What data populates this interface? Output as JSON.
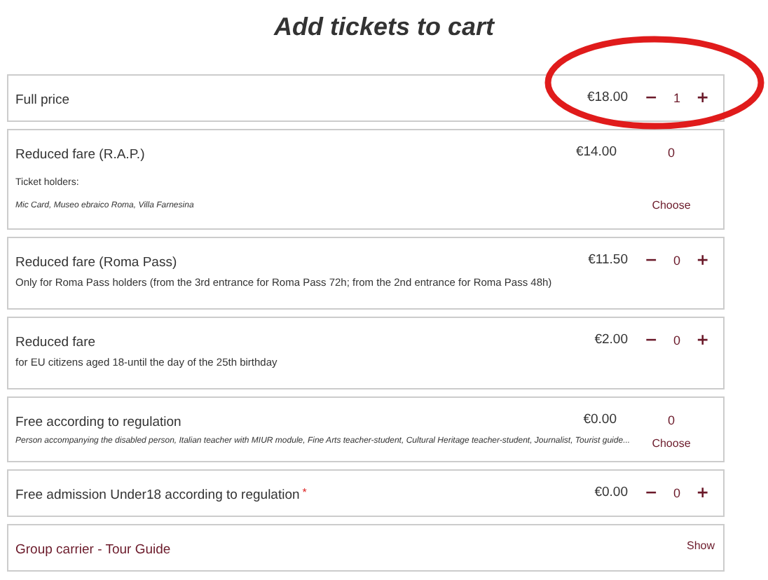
{
  "title": "Add tickets to cart",
  "tickets": [
    {
      "kind": "stepper",
      "name": "Full price",
      "price": "€18.00",
      "minus": "−",
      "quantity": "1",
      "plus": "+"
    },
    {
      "kind": "choose",
      "name": "Reduced fare (R.A.P.)",
      "price": "€14.00",
      "quantity": "0",
      "holders_label": "Ticket holders:",
      "note": "Mic Card, Museo ebraico Roma, Villa Farnesina",
      "action": "Choose"
    },
    {
      "kind": "stepper",
      "name": "Reduced fare (Roma Pass)",
      "price": "€11.50",
      "minus": "−",
      "quantity": "0",
      "plus": "+",
      "description": "Only for Roma Pass holders (from the 3rd entrance for Roma Pass 72h; from the 2nd entrance for Roma Pass 48h)"
    },
    {
      "kind": "stepper",
      "name": "Reduced fare",
      "price": "€2.00",
      "minus": "−",
      "quantity": "0",
      "plus": "+",
      "description": "for EU citizens aged 18-until the day of the 25th birthday"
    },
    {
      "kind": "choose",
      "name": "Free according to regulation",
      "price": "€0.00",
      "quantity": "0",
      "note": "Person accompanying the disabled person, Italian teacher with MIUR module, Fine Arts teacher-student, Cultural Heritage teacher-student, Journalist, Tourist guide...",
      "action": "Choose"
    },
    {
      "kind": "stepper",
      "name": "Free admission Under18 according to regulation",
      "required_mark": "*",
      "price": "€0.00",
      "minus": "−",
      "quantity": "0",
      "plus": "+"
    },
    {
      "kind": "show",
      "name": "Group carrier - Tour Guide",
      "action": "Show"
    }
  ]
}
